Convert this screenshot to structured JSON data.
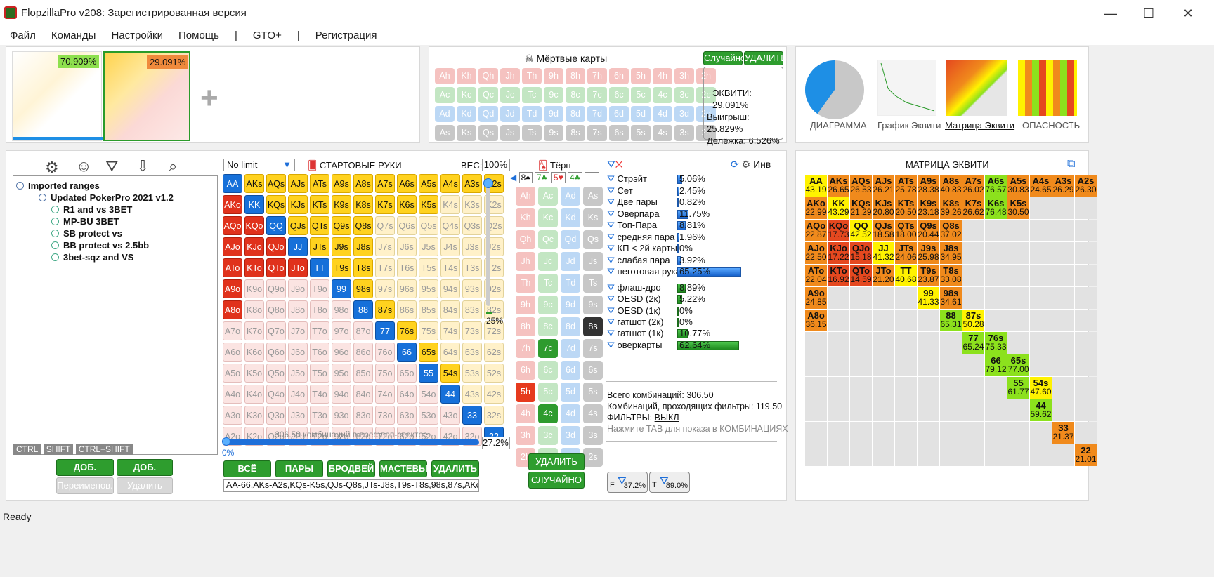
{
  "window": {
    "title": "FlopzillaPro v208: Зарегистрированная версия",
    "min": "—",
    "max": "☐",
    "close": "✕"
  },
  "menu": [
    "Файл",
    "Команды",
    "Настройки",
    "Помощь",
    "|",
    "GTO+",
    "|",
    "Регистрация"
  ],
  "ranges_top": {
    "p1": "70.909%",
    "p2": "29.091%",
    "add": "+"
  },
  "dead_cards": {
    "title": "Мёртвые карты",
    "random": "Случайно",
    "delete": "УДАЛИТЬ",
    "rows": [
      [
        "Ah",
        "Kh",
        "Qh",
        "Jh",
        "Th",
        "9h",
        "8h",
        "7h",
        "6h",
        "5h",
        "4h",
        "3h",
        "2h"
      ],
      [
        "Ac",
        "Kc",
        "Qc",
        "Jc",
        "Tc",
        "9c",
        "8c",
        "7c",
        "6c",
        "5c",
        "4c",
        "3c",
        "2c"
      ],
      [
        "Ad",
        "Kd",
        "Qd",
        "Jd",
        "Td",
        "9d",
        "8d",
        "7d",
        "6d",
        "5d",
        "4d",
        "3d",
        "2d"
      ],
      [
        "As",
        "Ks",
        "Qs",
        "Js",
        "Ts",
        "9s",
        "8s",
        "7s",
        "6s",
        "5s",
        "4s",
        "3s",
        "2s"
      ]
    ]
  },
  "equity": {
    "eq": "ЭКВИТИ: 29.091%",
    "win": "Выигрыш: 25.829%",
    "tie": "Делёжка: 6.526%"
  },
  "views": [
    {
      "label": "ДИАГРАММА"
    },
    {
      "label": "График Эквити"
    },
    {
      "label": "Матрица Эквити"
    },
    {
      "label": "ОПАСНОСТЬ"
    }
  ],
  "pie": {
    "slice1": 40.1,
    "slice2": 59.9,
    "label1": "40.1%",
    "label2": "59.9%"
  },
  "left": {
    "tree": [
      "Imported ranges",
      "Updated PokerPro 2021 v1.2",
      "R1 and vs 3BET",
      "MP-BU 3BET",
      "SB protect vs",
      "BB protect vs 2.5bb",
      "3bet-sqz and VS"
    ],
    "keys": [
      "CTRL",
      "SHIFT",
      "CTRL+SHIFT"
    ],
    "add_range": "ДОБ. СПЕКТР",
    "add_folder": "ДОБ. ПАПКУ",
    "rename": "Переименов.",
    "delete": "Удалить"
  },
  "hands": {
    "mode": "No limit",
    "title": "СТАРТОВЫЕ РУКИ",
    "weight_label": "ВЕС:",
    "weight": "100%",
    "slider": "25%",
    "combos": "306.50 комбинаций в префлоп-спектре",
    "pct": "27.2%",
    "zero": "0%",
    "buttons": [
      "ВСЁ",
      "ПАРЫ",
      "БРОДВЕЙ",
      "МАСТЕВЫЕ",
      "УДАЛИТЬ"
    ],
    "range_text": "AA-66,AKs-A2s,KQs-K5s,QJs-Q8s,JTs-J8s,T9s-T8s,98s,87s,AKo-A8o"
  },
  "turn": {
    "title": "Тёрн",
    "board": [
      "8♠",
      "7♣",
      "5♥",
      "4♣"
    ],
    "delete": "УДАЛИТЬ",
    "random": "СЛУЧАЙНО"
  },
  "stats": {
    "rows": [
      [
        "Стрэйт",
        "5.06%",
        5.06
      ],
      [
        "Сет",
        "2.45%",
        2.45
      ],
      [
        "Две пары",
        "0.82%",
        0.82
      ],
      [
        "Оверпара",
        "11.75%",
        11.75
      ],
      [
        "Топ-Пара",
        "8.81%",
        8.81
      ],
      [
        "средняя пара",
        "1.96%",
        1.96
      ],
      [
        "КП < 2й карты",
        "0%",
        0
      ],
      [
        "слабая пара",
        "3.92%",
        3.92
      ],
      [
        "неготовая рука",
        "65.25%",
        65.25
      ]
    ],
    "draws": [
      [
        "флаш-дро",
        "8.89%",
        8.89
      ],
      [
        "OESD (2к)",
        "5.22%",
        5.22
      ],
      [
        "OESD (1к)",
        "0%",
        0
      ],
      [
        "гатшот (2к)",
        "0%",
        0
      ],
      [
        "гатшот (1к)",
        "10.77%",
        10.77
      ],
      [
        "оверкарты",
        "62.64%",
        62.64
      ]
    ],
    "inv": "Инв",
    "total": "Всего комбинаций: 306.50",
    "pass": "Комбинаций, проходящих фильтры: 119.50",
    "filters_label": "ФИЛЬТРЫ:",
    "filters_val": "ВЫКЛ",
    "tab_hint": "Нажмите TAB для показа в КОМБИНАЦИЯХ",
    "f": "37.2%",
    "t": "89.0%",
    "fl": "F",
    "tl": "T"
  },
  "matrix": {
    "title": "МАТРИЦА ЭКВИТИ",
    "rows": [
      [
        [
          "AA",
          "43.19",
          "y"
        ],
        [
          "AKs",
          "26.65",
          "o"
        ],
        [
          "AQs",
          "26.53",
          "o"
        ],
        [
          "AJs",
          "26.21",
          "o"
        ],
        [
          "ATs",
          "25.78",
          "o"
        ],
        [
          "A9s",
          "28.38",
          "o"
        ],
        [
          "A8s",
          "40.83",
          "o"
        ],
        [
          "A7s",
          "26.02",
          "o"
        ],
        [
          "A6s",
          "76.57",
          "g"
        ],
        [
          "A5s",
          "30.83",
          "o"
        ],
        [
          "A4s",
          "24.65",
          "o"
        ],
        [
          "A3s",
          "26.29",
          "o"
        ],
        [
          "A2s",
          "26.30",
          "o"
        ]
      ],
      [
        [
          "AKo",
          "22.99",
          "o"
        ],
        [
          "KK",
          "43.29",
          "y"
        ],
        [
          "KQs",
          "21.29",
          "o"
        ],
        [
          "KJs",
          "20.80",
          "o"
        ],
        [
          "KTs",
          "20.50",
          "o"
        ],
        [
          "K9s",
          "23.18",
          "o"
        ],
        [
          "K8s",
          "39.26",
          "o"
        ],
        [
          "K7s",
          "26.62",
          "o"
        ],
        [
          "K6s",
          "76.48",
          "g"
        ],
        [
          "K5s",
          "30.50",
          "o"
        ]
      ],
      [
        [
          "AQo",
          "22.87",
          "o"
        ],
        [
          "KQo",
          "17.73",
          "r"
        ],
        [
          "QQ",
          "42.52",
          "y"
        ],
        [
          "QJs",
          "18.58",
          "o"
        ],
        [
          "QTs",
          "18.00",
          "o"
        ],
        [
          "Q9s",
          "20.44",
          "o"
        ],
        [
          "Q8s",
          "37.02",
          "o"
        ]
      ],
      [
        [
          "AJo",
          "22.50",
          "o"
        ],
        [
          "KJo",
          "17.22",
          "r"
        ],
        [
          "QJo",
          "15.18",
          "r"
        ],
        [
          "JJ",
          "41.32",
          "y"
        ],
        [
          "JTs",
          "24.06",
          "o"
        ],
        [
          "J9s",
          "25.98",
          "o"
        ],
        [
          "J8s",
          "34.95",
          "o"
        ]
      ],
      [
        [
          "ATo",
          "22.04",
          "o"
        ],
        [
          "KTo",
          "16.92",
          "r"
        ],
        [
          "QTo",
          "14.59",
          "r"
        ],
        [
          "JTo",
          "21.20",
          "o"
        ],
        [
          "TT",
          "40.68",
          "y"
        ],
        [
          "T9s",
          "23.87",
          "o"
        ],
        [
          "T8s",
          "33.08",
          "o"
        ]
      ],
      [
        [
          "A9o",
          "24.85",
          "o"
        ],
        "",
        "",
        "",
        "",
        [
          "99",
          "41.33",
          "y"
        ],
        [
          "98s",
          "34.61",
          "o"
        ]
      ],
      [
        [
          "A8o",
          "36.15",
          "o"
        ],
        "",
        "",
        "",
        "",
        "",
        [
          "88",
          "65.31",
          "g"
        ],
        [
          "87s",
          "50.28",
          "y"
        ]
      ],
      [
        "",
        "",
        "",
        "",
        "",
        "",
        "",
        [
          "77",
          "65.24",
          "g"
        ],
        [
          "76s",
          "75.33",
          "g"
        ]
      ],
      [
        "",
        "",
        "",
        "",
        "",
        "",
        "",
        "",
        [
          "66",
          "79.12",
          "g"
        ],
        [
          "65s",
          "77.00",
          "g"
        ]
      ],
      [
        "",
        "",
        "",
        "",
        "",
        "",
        "",
        "",
        "",
        [
          "55",
          "61.77",
          "g"
        ],
        [
          "54s",
          "47.60",
          "y"
        ]
      ],
      [
        "",
        "",
        "",
        "",
        "",
        "",
        "",
        "",
        "",
        "",
        [
          "44",
          "59.62",
          "g"
        ]
      ],
      [
        "",
        "",
        "",
        "",
        "",
        "",
        "",
        "",
        "",
        "",
        "",
        [
          "33",
          "21.37",
          "o"
        ]
      ],
      [
        "",
        "",
        "",
        "",
        "",
        "",
        "",
        "",
        "",
        "",
        "",
        "",
        [
          "22",
          "21.01",
          "o"
        ]
      ]
    ]
  },
  "status": "Ready"
}
